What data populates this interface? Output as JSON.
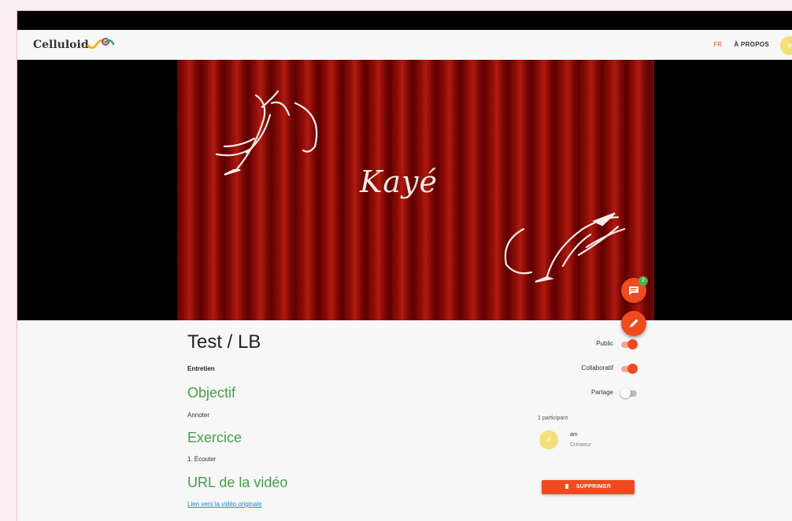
{
  "navbar": {
    "logo_text": "Celluloid",
    "lang": "FR",
    "about": "À PROPOS",
    "avatar_initial": "a"
  },
  "video": {
    "poster_title": "Kayé",
    "comments_badge": "2",
    "chat_icon": "chat-icon",
    "edit_icon": "pencil-icon"
  },
  "project": {
    "title": "Test / LB",
    "type": "Entretien",
    "objective_heading": "Objectif",
    "objective_value": "Annoter",
    "exercise_heading": "Exercice",
    "exercise_value": "1. Écouter",
    "url_heading": "URL de la vidéo",
    "url_link": "Lien vers la vidéo originale"
  },
  "settings": {
    "public_label": "Public",
    "public_on": true,
    "collab_label": "Collaboratif",
    "collab_on": true,
    "share_label": "Partage",
    "share_on": false
  },
  "participants": {
    "count_label": "1 participant",
    "items": [
      {
        "initial": "a",
        "name": "am",
        "role": "Créateur"
      }
    ]
  },
  "actions": {
    "delete_label": "SUPPRIMER"
  },
  "colors": {
    "accent": "#f04a1f",
    "green_heading": "#43a047",
    "link": "#1e88e5"
  }
}
